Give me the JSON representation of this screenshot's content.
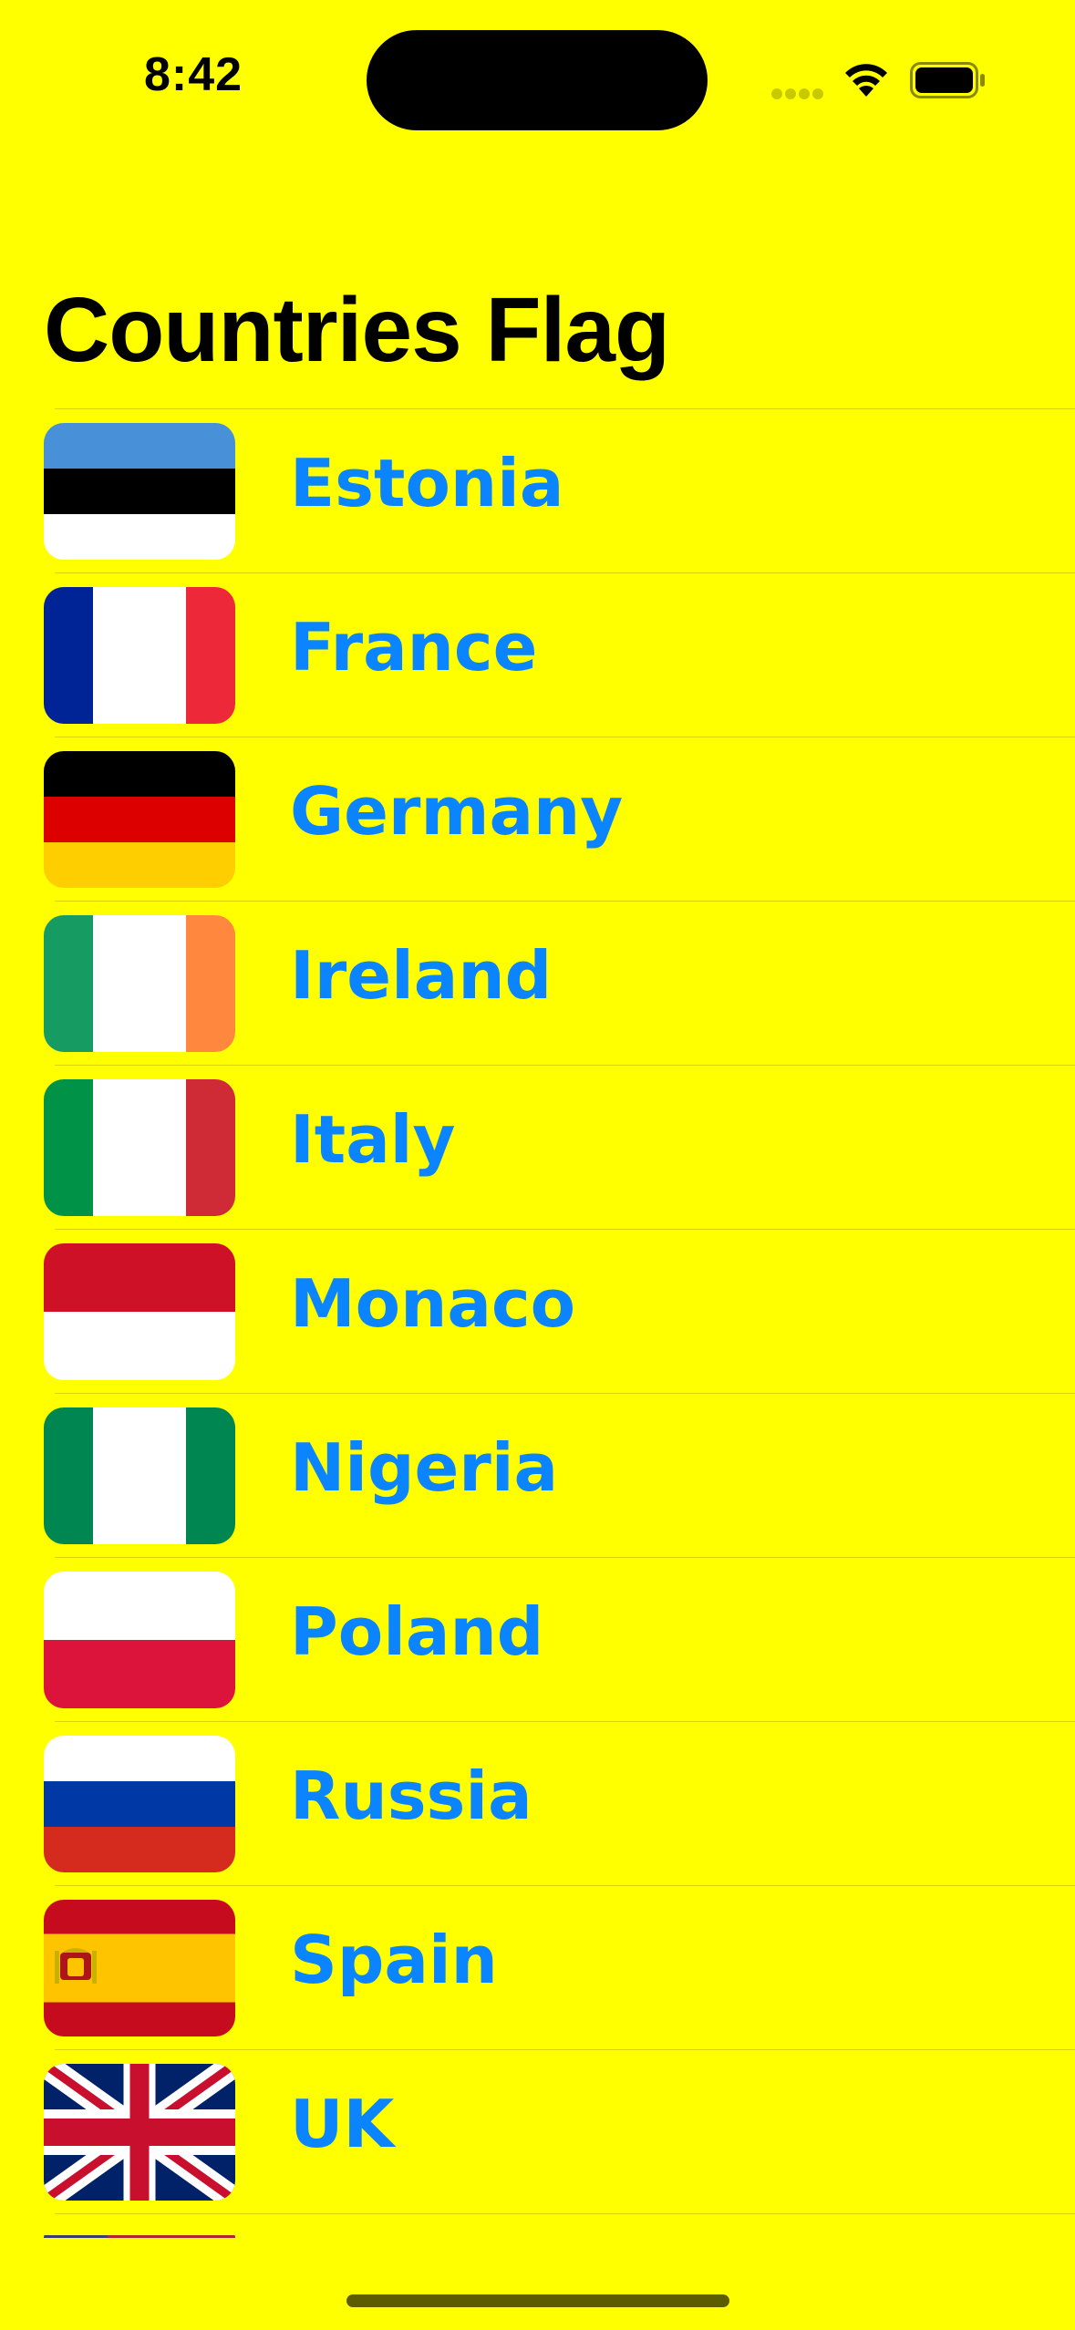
{
  "status_bar": {
    "time": "8:42",
    "icons": [
      "signal-dots-icon",
      "wifi-icon",
      "battery-icon"
    ]
  },
  "page": {
    "title": "Countries Flag",
    "background": "#ffff00",
    "accent": "#0a84ff"
  },
  "countries": [
    {
      "name": "Estonia",
      "flag": "estonia-flag-icon"
    },
    {
      "name": "France",
      "flag": "france-flag-icon"
    },
    {
      "name": "Germany",
      "flag": "germany-flag-icon"
    },
    {
      "name": "Ireland",
      "flag": "ireland-flag-icon"
    },
    {
      "name": "Italy",
      "flag": "italy-flag-icon"
    },
    {
      "name": "Monaco",
      "flag": "monaco-flag-icon"
    },
    {
      "name": "Nigeria",
      "flag": "nigeria-flag-icon"
    },
    {
      "name": "Poland",
      "flag": "poland-flag-icon"
    },
    {
      "name": "Russia",
      "flag": "russia-flag-icon"
    },
    {
      "name": "Spain",
      "flag": "spain-flag-icon"
    },
    {
      "name": "UK",
      "flag": "uk-flag-icon"
    }
  ]
}
